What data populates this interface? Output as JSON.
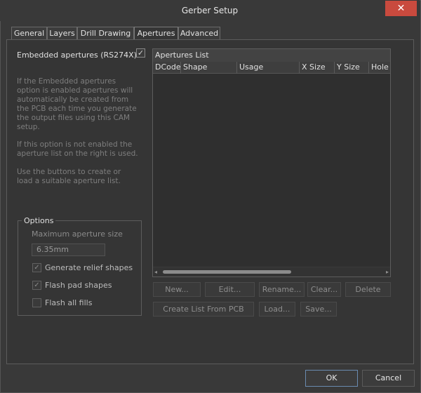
{
  "window": {
    "title": "Gerber Setup",
    "close_glyph": "✕"
  },
  "tabs": [
    {
      "label": "General"
    },
    {
      "label": "Layers"
    },
    {
      "label": "Drill Drawing"
    },
    {
      "label": "Apertures"
    },
    {
      "label": "Advanced"
    }
  ],
  "active_tab": "Apertures",
  "embedded": {
    "label": "Embedded apertures (RS274X)",
    "checked": true,
    "check_glyph": "✓"
  },
  "help": {
    "p1": [
      "If the Embedded apertures",
      "option is enabled apertures will",
      "automatically be created from",
      "the PCB each time you generate",
      "the output files using this CAM",
      "setup."
    ],
    "p2": [
      "If this option is not enabled the",
      "aperture list on the right is used."
    ],
    "p3": [
      "Use the buttons to create or",
      "load a suitable aperture list."
    ]
  },
  "options": {
    "title": "Options",
    "max_size_label": "Maximum aperture size",
    "max_size_value": "6.35mm",
    "generate_relief": {
      "label": "Generate relief shapes",
      "checked": true
    },
    "flash_pad": {
      "label": "Flash pad shapes",
      "checked": true
    },
    "flash_fills": {
      "label": "Flash all fills",
      "checked": false
    }
  },
  "apertures_list": {
    "title": "Apertures List",
    "columns": [
      "DCode",
      "Shape",
      "Usage",
      "X Size",
      "Y Size",
      "Hole"
    ],
    "rows": []
  },
  "buttons": {
    "new": "New...",
    "edit": "Edit...",
    "rename": "Rename...",
    "clear": "Clear...",
    "delete": "Delete",
    "create_list": "Create List From PCB",
    "load": "Load...",
    "save": "Save...",
    "ok": "OK",
    "cancel": "Cancel"
  },
  "scrollbar": {
    "left_glyph": "◂",
    "right_glyph": "▸"
  },
  "colors": {
    "background": "#393939",
    "close_button": "#c94a3e",
    "ok_border": "#6a8bb0"
  }
}
